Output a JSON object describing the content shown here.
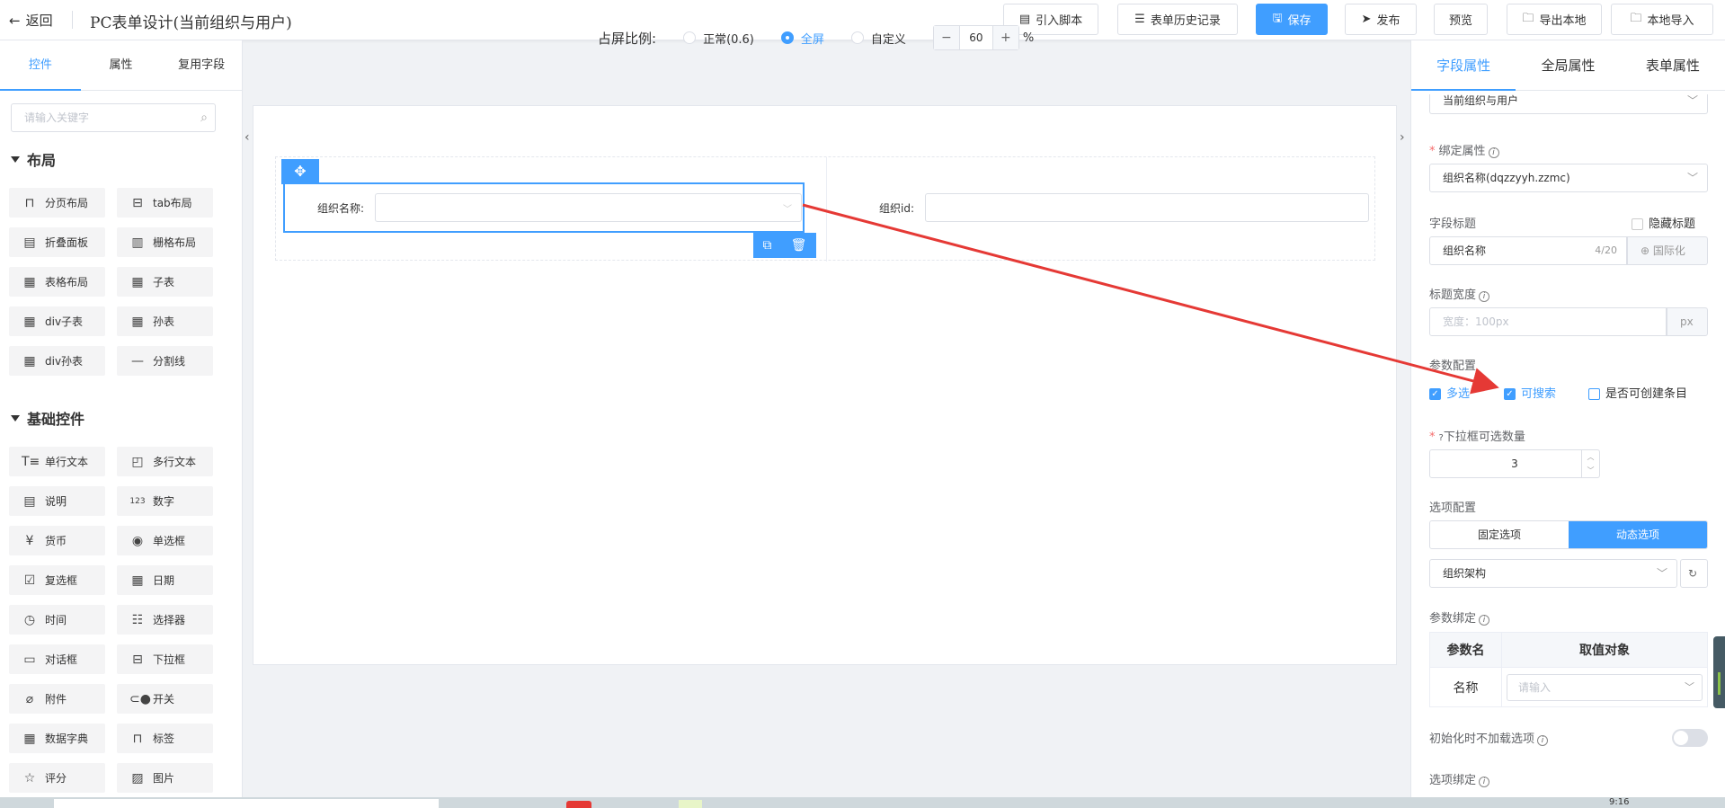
{
  "header": {
    "back_label": "返回",
    "title": "PC表单设计(当前组织与用户)",
    "buttons": {
      "import_script": "引入脚本",
      "history": "表单历史记录",
      "save": "保存",
      "publish": "发布",
      "preview": "预览",
      "export": "导出本地",
      "import_local": "本地导入"
    }
  },
  "left_panel": {
    "tabs": [
      "控件",
      "属性",
      "复用字段"
    ],
    "active_tab": "控件",
    "search_placeholder": "请输入关键字",
    "sections": {
      "layout": "布局",
      "basic": "基础控件"
    },
    "layout_items": [
      "分页布局",
      "tab布局",
      "折叠面板",
      "栅格布局",
      "表格布局",
      "子表",
      "div子表",
      "孙表",
      "div孙表",
      "分割线"
    ],
    "basic_items": [
      "单行文本",
      "多行文本",
      "说明",
      "数字",
      "货币",
      "单选框",
      "复选框",
      "日期",
      "时间",
      "选择器",
      "对话框",
      "下拉框",
      "附件",
      "开关",
      "数据字典",
      "标签",
      "评分",
      "图片"
    ]
  },
  "canvas": {
    "ratio_label": "占屏比例:",
    "options": [
      "正常(0.6)",
      "全屏",
      "自定义"
    ],
    "selected": "全屏",
    "zoom_value": "60",
    "zoom_unit": "%",
    "zoom_minus": "−",
    "zoom_plus": "+",
    "fields": [
      {
        "label": "组织名称:"
      },
      {
        "label": "组织id:"
      }
    ]
  },
  "right_panel": {
    "tabs": [
      "字段属性",
      "全局属性",
      "表单属性"
    ],
    "active_tab": "字段属性",
    "control_type": "当前组织与用户",
    "bind_attr_label": "绑定属性",
    "bind_attr_value": "组织名称(dqzzyyh.zzmc)",
    "field_title_label": "字段标题",
    "hide_title_label": "隐藏标题",
    "field_title_value": "组织名称",
    "field_title_count": "4/20",
    "i18n_label": "国际化",
    "title_width_label": "标题宽度",
    "title_width_placeholder": "宽度：100px",
    "title_width_unit": "px",
    "param_config_label": "参数配置",
    "param_options": [
      {
        "label": "多选",
        "checked": true
      },
      {
        "label": "可搜索",
        "checked": true
      },
      {
        "label": "是否可创建条目",
        "checked": false
      }
    ],
    "dropdown_count_label": "下拉框可选数量",
    "dropdown_count_value": "3",
    "option_config_label": "选项配置",
    "option_modes": [
      "固定选项",
      "动态选项"
    ],
    "option_mode_selected": "动态选项",
    "option_source": "组织架构",
    "param_bind_label": "参数绑定",
    "param_table": {
      "headers": [
        "参数名",
        "取值对象"
      ],
      "rows": [
        {
          "name": "名称",
          "value_placeholder": "请输入"
        }
      ]
    },
    "no_load_label": "初始化时不加载选项",
    "option_bind_label": "选项绑定"
  },
  "taskbar": {
    "clock": "9:16"
  },
  "colors": {
    "primary": "#409eff",
    "arrow": "#e53935"
  }
}
